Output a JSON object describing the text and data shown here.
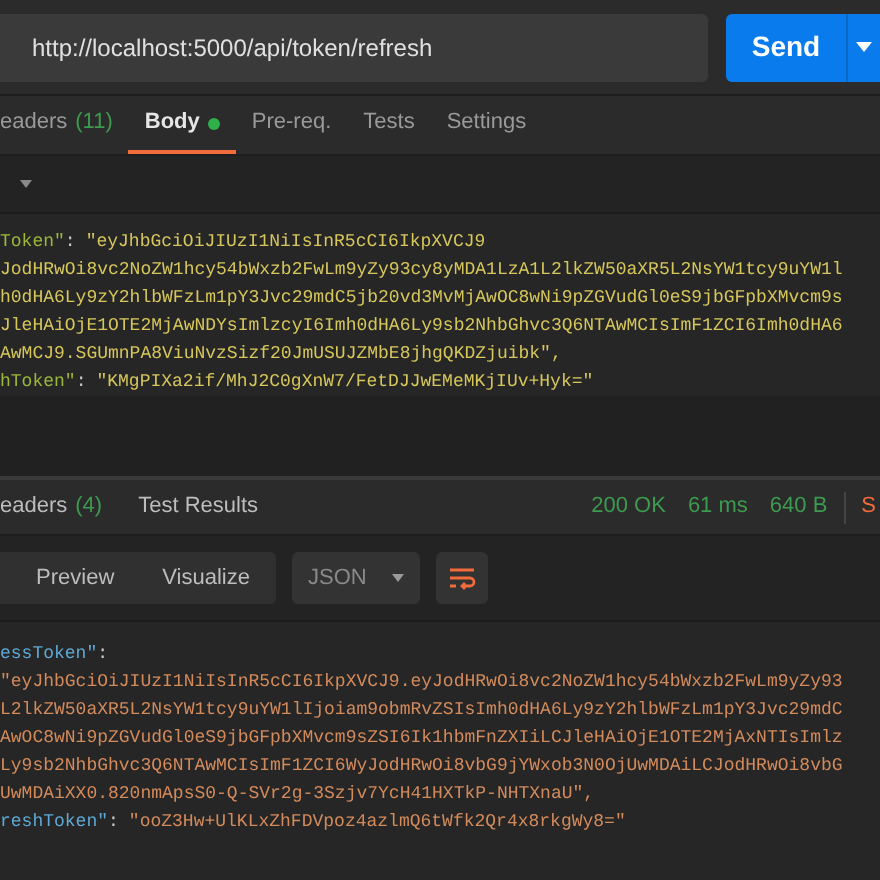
{
  "url": "http://localhost:5000/api/token/refresh",
  "send_label": "Send",
  "request_tabs": [
    {
      "label": "eaders",
      "count": "(11)",
      "selected": false,
      "dot": false
    },
    {
      "label": "Body",
      "selected": true,
      "dot": true
    },
    {
      "label": "Pre-req.",
      "selected": false,
      "dot": false
    },
    {
      "label": "Tests",
      "selected": false,
      "dot": false
    },
    {
      "label": "Settings",
      "selected": false,
      "dot": false
    }
  ],
  "request_body": [
    {
      "kind": "pair",
      "key": "Token\"",
      "colon": ":",
      "value": "\"eyJhbGciOiJIUzI1NiIsInR5cCI6IkpXVCJ9"
    },
    {
      "kind": "text",
      "value": "JodHRwOi8vc2NoZW1hcy54bWxzb2FwLm9yZy93cy8yMDA1LzA1L2lkZW50aXR5L2NsYW1tcy9uYW1l"
    },
    {
      "kind": "text",
      "value": "h0dHA6Ly9zY2hlbWFzLm1pY3Jvc29mdC5jb20vd3MvMjAwOC8wNi9pZGVudGl0eS9jbGFpbXMvcm9s"
    },
    {
      "kind": "text",
      "value": "JleHAiOjE1OTE2MjAwNDYsImlzcyI6Imh0dHA6Ly9sb2NhbGhvc3Q6NTAwMCIsImF1ZCI6Imh0dHA6"
    },
    {
      "kind": "text",
      "value": "AwMCJ9.SGUmnPA8ViuNvzSizf20JmUSUJZMbE8jhgQKDZjuibk\","
    },
    {
      "kind": "pair",
      "key": "hToken\"",
      "colon": ":",
      "value": "\"KMgPIXa2if/MhJ2C0gXnW7/FetDJJwEMeMKjIUv+Hyk=\""
    }
  ],
  "response_tabs": [
    {
      "label": "eaders",
      "count": "(4)"
    },
    {
      "label": "Test Results"
    }
  ],
  "status": {
    "code": "200 OK",
    "time": "61 ms",
    "size": "640 B",
    "save": "S"
  },
  "view_modes": [
    {
      "label": "Preview"
    },
    {
      "label": "Visualize"
    }
  ],
  "format": "JSON",
  "response_body": [
    {
      "kind": "pair",
      "key": "essToken\"",
      "colon": ":"
    },
    {
      "kind": "text",
      "value": "\"eyJhbGciOiJIUzI1NiIsInR5cCI6IkpXVCJ9.eyJodHRwOi8vc2NoZW1hcy54bWxzb2FwLm9yZy93"
    },
    {
      "kind": "text",
      "value": "L2lkZW50aXR5L2NsYW1tcy9uYW1lIjoiam9obmRvZSIsImh0dHA6Ly9zY2hlbWFzLm1pY3Jvc29mdC"
    },
    {
      "kind": "text",
      "value": "AwOC8wNi9pZGVudGl0eS9jbGFpbXMvcm9sZSI6Ik1hbmFnZXIiLCJleHAiOjE1OTE2MjAxNTIsImlz"
    },
    {
      "kind": "text",
      "value": "Ly9sb2NhbGhvc3Q6NTAwMCIsImF1ZCI6WyJodHRwOi8vbG9jYWxob3N0OjUwMDAiLCJodHRwOi8vbG"
    },
    {
      "kind": "text",
      "value": "UwMDAiXX0.820nmApsS0-Q-SVr2g-3Szjv7YcH41HXTkP-NHTXnaU\","
    },
    {
      "kind": "pair",
      "key": "reshToken\"",
      "colon": ":",
      "value": "\"ooZ3Hw+UlKLxZhFDVpoz4azlmQ6tWfk2Qr4x8rkgWy8=\""
    }
  ]
}
